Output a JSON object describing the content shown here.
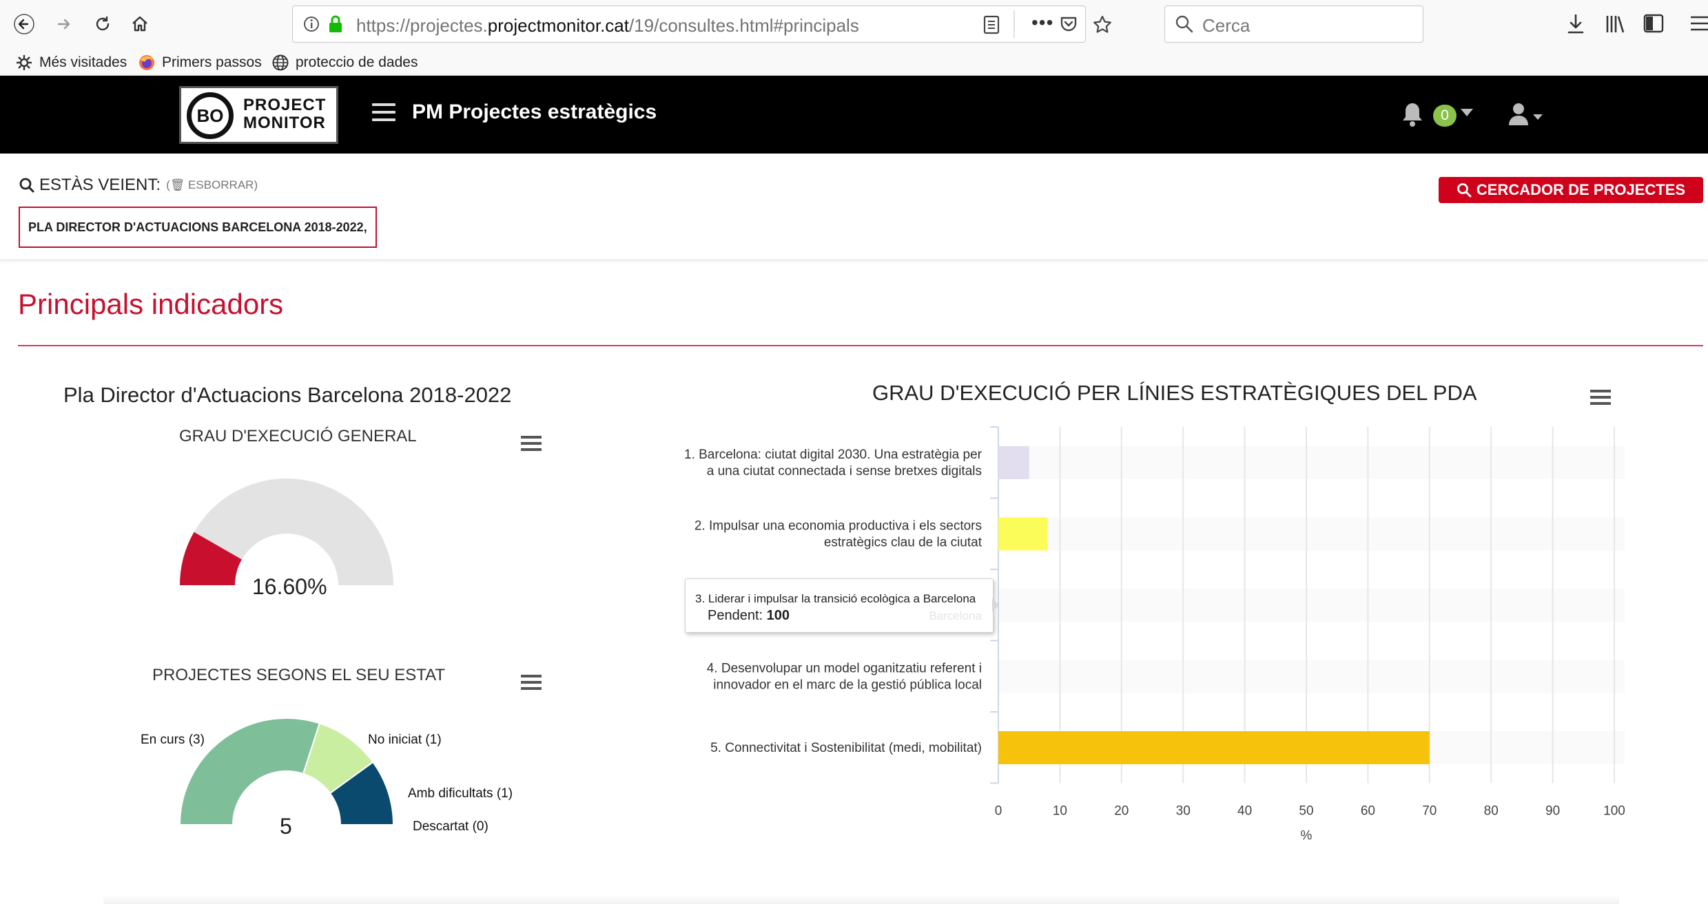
{
  "browser": {
    "url_prefix": "https://projectes.",
    "url_domain": "projectmonitor.cat",
    "url_path": "/19/consultes.html#principals",
    "search_placeholder": "Cerca",
    "bookmarks": [
      {
        "label": "Més visitades",
        "icon": "gear-icon"
      },
      {
        "label": "Primers passos",
        "icon": "firefox-icon"
      },
      {
        "label": "proteccio de dades",
        "icon": "globe-icon"
      }
    ]
  },
  "header": {
    "logo_circle": "BO",
    "logo_line1": "PROJECT",
    "logo_line2": "MONITOR",
    "app_title": "PM Projectes estratègics",
    "notifications_count": "0"
  },
  "filter": {
    "viewing_label": "ESTÀS VEIENT:",
    "clear_label": "(🗑 ESBORRAR)",
    "tag": "PLA DIRECTOR D'ACTUACIONS BARCELONA 2018-2022,",
    "search_button": "CERCADOR DE PROJECTES"
  },
  "main": {
    "section_title": "Principals indicadors",
    "left_subtitle": "Pla Director d'Actuacions Barcelona 2018-2022",
    "gauge_title": "GRAU D'EXECUCIÓ GENERAL",
    "gauge_value": "16.60%",
    "status_title": "PROJECTES SEGONS EL SEU ESTAT",
    "status_total": "5",
    "bar_title": "GRAU D'EXECUCIÓ PER LÍNIES ESTRATÈGIQUES DEL PDA"
  },
  "tooltip": {
    "title": "3. Liderar i impulsar la transició ecològica a Barcelona",
    "ghost": "Barcelona",
    "label": "Pendent:",
    "value": "100"
  },
  "chart_data": [
    {
      "type": "gauge",
      "title": "GRAU D'EXECUCIÓ GENERAL",
      "value": 16.6,
      "max": 100,
      "unit": "%",
      "colors": {
        "value": "#c8102e",
        "remaining": "#e3e3e3"
      }
    },
    {
      "type": "pie",
      "title": "PROJECTES SEGONS EL SEU ESTAT",
      "semicircle": true,
      "total": 5,
      "slices": [
        {
          "label": "En curs (3)",
          "value": 3,
          "color": "#7ebf9a"
        },
        {
          "label": "No iniciat (1)",
          "value": 1,
          "color": "#c9eea0"
        },
        {
          "label": "Amb dificultats (1)",
          "value": 1,
          "color": "#0b4a6f"
        },
        {
          "label": "Descartat (0)",
          "value": 0,
          "color": "#333333"
        }
      ]
    },
    {
      "type": "bar",
      "orientation": "horizontal",
      "title": "GRAU D'EXECUCIÓ PER LÍNIES ESTRATÈGIQUES DEL PDA",
      "categories": [
        [
          "1. Barcelona: ciutat digital 2030. Una estratègia per",
          "a una ciutat connectada i sense bretxes digitals"
        ],
        [
          "2. Impulsar una economia productiva i els sectors",
          "estratègics clau de la ciutat"
        ],
        [
          "3. Liderar i impulsar la transició ecològica a Barcelona"
        ],
        [
          "4. Desenvolupar un model oganitzatiu referent i",
          "innovador en el marc de la gestió pública local"
        ],
        [
          "5. Connectivitat i Sostenibilitat (medi, mobilitat)"
        ]
      ],
      "values": [
        5,
        8,
        0,
        0,
        70
      ],
      "colors": [
        "#e2ddef",
        "#fbfc5a",
        "#f0f0f0",
        "#f0f0f0",
        "#f7c20c"
      ],
      "xlabel": "%",
      "xlim": [
        0,
        100
      ],
      "xticks": [
        0,
        10,
        20,
        30,
        40,
        50,
        60,
        70,
        80,
        90,
        100
      ],
      "grid": true
    }
  ]
}
